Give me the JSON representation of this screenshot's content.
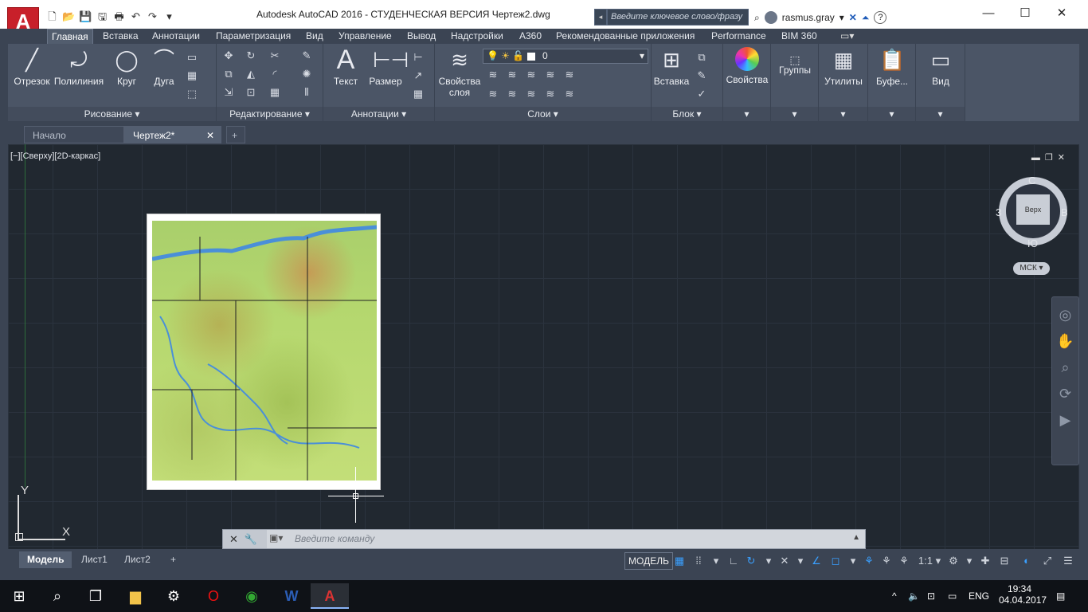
{
  "window": {
    "title": "Autodesk AutoCAD 2016 - СТУДЕНЧЕСКАЯ ВЕРСИЯ     Чертеж2.dwg",
    "search_placeholder": "Введите ключевое слово/фразу",
    "user": "rasmus.gray",
    "help": "?",
    "minimize": "—",
    "maximize": "☐",
    "close": "✕"
  },
  "ribbon_tabs": [
    "Главная",
    "Вставка",
    "Аннотации",
    "Параметризация",
    "Вид",
    "Управление",
    "Вывод",
    "Надстройки",
    "A360",
    "Рекомендованные приложения",
    "Performance",
    "BIM 360"
  ],
  "ribbon": {
    "draw": {
      "title": "Рисование ▾",
      "line": "Отрезок",
      "polyline": "Полилиния",
      "circle": "Круг",
      "arc": "Дуга"
    },
    "modify": {
      "title": "Редактирование ▾"
    },
    "annotation": {
      "title": "Аннотации ▾",
      "text": "Текст",
      "dimension": "Размер"
    },
    "layers": {
      "title": "Слои ▾",
      "layer_props": "Свойства слоя",
      "current_layer": "0"
    },
    "block": {
      "title": "Блок ▾",
      "insert": "Вставка"
    },
    "properties": "Свойства",
    "groups": "Группы",
    "utilities": "Утилиты",
    "clipboard": "Буфе...",
    "view": "Вид"
  },
  "file_tabs": {
    "start": "Начало",
    "drawing": "Чертеж2*",
    "add": "+"
  },
  "viewport": {
    "label": "[−][Сверху][2D-каркас]",
    "viewcube": {
      "face": "Верх",
      "n": "С",
      "s": "Ю",
      "e": "В",
      "w": "З"
    },
    "ucs_menu": "МСК ▾",
    "ucs_x": "X",
    "ucs_y": "Y"
  },
  "command": {
    "placeholder": "Введите команду"
  },
  "layout_tabs": [
    "Модель",
    "Лист1",
    "Лист2",
    "+"
  ],
  "status": {
    "model": "МОДЕЛЬ",
    "scale": "1:1 ▾"
  },
  "taskbar": {
    "lang": "ENG",
    "time": "19:34",
    "date": "04.04.2017"
  }
}
